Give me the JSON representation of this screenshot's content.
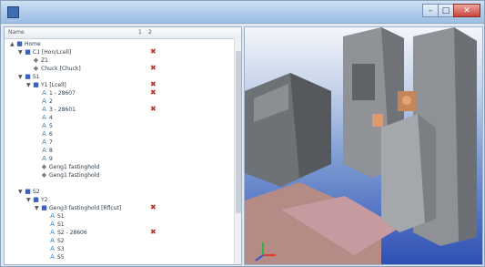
{
  "window": {
    "title": ""
  },
  "tree": {
    "columns": [
      "Name",
      "1",
      "2"
    ],
    "rows": [
      {
        "indent": 0,
        "expander": "▲",
        "icon": "folder",
        "label": "Home",
        "marked": false
      },
      {
        "indent": 1,
        "expander": "▼",
        "icon": "folder",
        "label": "C1 [Hon/Lcell]",
        "marked": true
      },
      {
        "indent": 2,
        "expander": "",
        "icon": "part",
        "label": "Z1",
        "marked": false
      },
      {
        "indent": 2,
        "expander": "",
        "icon": "part",
        "label": "Chuck [Chuck]",
        "marked": true
      },
      {
        "indent": 1,
        "expander": "▼",
        "icon": "folder",
        "label": "S1",
        "marked": false
      },
      {
        "indent": 2,
        "expander": "▼",
        "icon": "folder",
        "label": "Y1 [Lcell]",
        "marked": true
      },
      {
        "indent": 3,
        "expander": "",
        "icon": "axis",
        "label": "1 - 28607",
        "marked": true
      },
      {
        "indent": 3,
        "expander": "",
        "icon": "axis",
        "label": "2",
        "marked": false
      },
      {
        "indent": 3,
        "expander": "",
        "icon": "axis",
        "label": "3 - 28601",
        "marked": true
      },
      {
        "indent": 3,
        "expander": "",
        "icon": "axis",
        "label": "4",
        "marked": false
      },
      {
        "indent": 3,
        "expander": "",
        "icon": "axis",
        "label": "5",
        "marked": false
      },
      {
        "indent": 3,
        "expander": "",
        "icon": "axis",
        "label": "6",
        "marked": false
      },
      {
        "indent": 3,
        "expander": "",
        "icon": "axis",
        "label": "7",
        "marked": false
      },
      {
        "indent": 3,
        "expander": "",
        "icon": "axis",
        "label": "8",
        "marked": false
      },
      {
        "indent": 3,
        "expander": "",
        "icon": "axis",
        "label": "9",
        "marked": false
      },
      {
        "indent": 3,
        "expander": "",
        "icon": "part",
        "label": "Geng1 fastinghold",
        "marked": false
      },
      {
        "indent": 3,
        "expander": "",
        "icon": "part",
        "label": "Geng1 fastinghold",
        "marked": false
      },
      {
        "indent": 0,
        "expander": "",
        "icon": "",
        "label": "",
        "marked": false
      },
      {
        "indent": 1,
        "expander": "▼",
        "icon": "folder",
        "label": "S2",
        "marked": false
      },
      {
        "indent": 2,
        "expander": "▼",
        "icon": "folder",
        "label": "Y2",
        "marked": false
      },
      {
        "indent": 3,
        "expander": "▼",
        "icon": "folder",
        "label": "Geng3 fastinghold [Rflcut]",
        "marked": true
      },
      {
        "indent": 4,
        "expander": "",
        "icon": "axis",
        "label": "S1",
        "marked": false
      },
      {
        "indent": 4,
        "expander": "",
        "icon": "axis",
        "label": "S1",
        "marked": false
      },
      {
        "indent": 4,
        "expander": "",
        "icon": "axis",
        "label": "S2 - 28606",
        "marked": true
      },
      {
        "indent": 4,
        "expander": "",
        "icon": "axis",
        "label": "S2",
        "marked": false
      },
      {
        "indent": 4,
        "expander": "",
        "icon": "axis",
        "label": "S3",
        "marked": false
      },
      {
        "indent": 4,
        "expander": "",
        "icon": "axis",
        "label": "S5",
        "marked": false
      }
    ]
  },
  "icons": {
    "folder": "■",
    "part": "◆",
    "axis": "A",
    "marker": "✖"
  },
  "colors": {
    "marker": "#c0312b",
    "viewport_bottom": "#2d4fb3"
  },
  "window_buttons": {
    "minimize": "–",
    "maximize": "□",
    "close": "✕"
  }
}
